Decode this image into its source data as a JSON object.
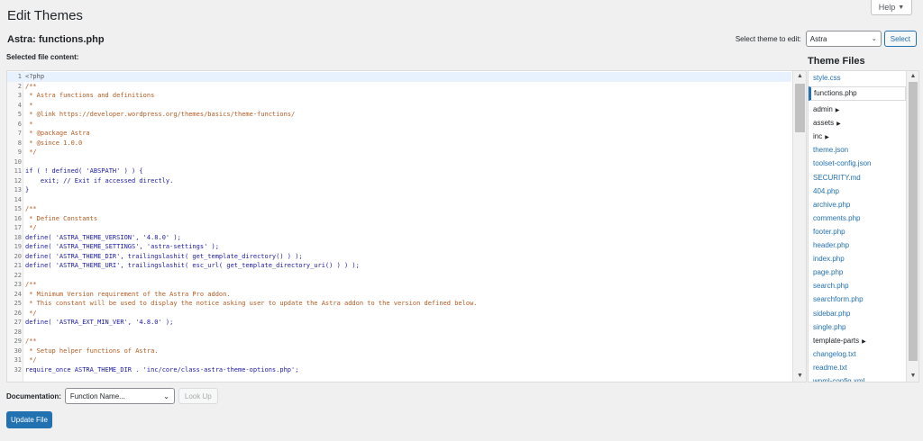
{
  "header": {
    "title": "Edit Themes",
    "help_label": "Help",
    "help_caret": "▼"
  },
  "file_heading": "Astra: functions.php",
  "theme_selector": {
    "label": "Select theme to edit:",
    "value": "Astra",
    "button_label": "Select"
  },
  "editor": {
    "label": "Selected file content:",
    "lines": [
      {
        "n": "1",
        "t": "<?php",
        "k": "php"
      },
      {
        "n": "2",
        "t": "/**",
        "k": "comment"
      },
      {
        "n": "3",
        "t": " * Astra functions and definitions",
        "k": "comment"
      },
      {
        "n": "4",
        "t": " *",
        "k": "comment"
      },
      {
        "n": "5",
        "t": " * @link https://developer.wordpress.org/themes/basics/theme-functions/",
        "k": "comment"
      },
      {
        "n": "6",
        "t": " *",
        "k": "comment"
      },
      {
        "n": "7",
        "t": " * @package Astra",
        "k": "comment"
      },
      {
        "n": "8",
        "t": " * @since 1.0.0",
        "k": "comment"
      },
      {
        "n": "9",
        "t": " */",
        "k": "comment"
      },
      {
        "n": "10",
        "t": "",
        "k": "plain"
      },
      {
        "n": "11",
        "t": "if ( ! defined( 'ABSPATH' ) ) {",
        "k": "kw"
      },
      {
        "n": "12",
        "t": "    exit; // Exit if accessed directly.",
        "k": "kw"
      },
      {
        "n": "13",
        "t": "}",
        "k": "kw"
      },
      {
        "n": "14",
        "t": "",
        "k": "plain"
      },
      {
        "n": "15",
        "t": "/**",
        "k": "comment"
      },
      {
        "n": "16",
        "t": " * Define Constants",
        "k": "comment"
      },
      {
        "n": "17",
        "t": " */",
        "k": "comment"
      },
      {
        "n": "18",
        "t": "define( 'ASTRA_THEME_VERSION', '4.8.0' );",
        "k": "kw"
      },
      {
        "n": "19",
        "t": "define( 'ASTRA_THEME_SETTINGS', 'astra-settings' );",
        "k": "kw"
      },
      {
        "n": "20",
        "t": "define( 'ASTRA_THEME_DIR', trailingslashit( get_template_directory() ) );",
        "k": "kw"
      },
      {
        "n": "21",
        "t": "define( 'ASTRA_THEME_URI', trailingslashit( esc_url( get_template_directory_uri() ) ) );",
        "k": "kw"
      },
      {
        "n": "22",
        "t": "",
        "k": "plain"
      },
      {
        "n": "23",
        "t": "/**",
        "k": "comment"
      },
      {
        "n": "24",
        "t": " * Minimum Version requirement of the Astra Pro addon.",
        "k": "comment"
      },
      {
        "n": "25",
        "t": " * This constant will be used to display the notice asking user to update the Astra addon to the version defined below.",
        "k": "comment"
      },
      {
        "n": "26",
        "t": " */",
        "k": "comment"
      },
      {
        "n": "27",
        "t": "define( 'ASTRA_EXT_MIN_VER', '4.8.0' );",
        "k": "kw"
      },
      {
        "n": "28",
        "t": "",
        "k": "plain"
      },
      {
        "n": "29",
        "t": "/**",
        "k": "comment"
      },
      {
        "n": "30",
        "t": " * Setup helper functions of Astra.",
        "k": "comment"
      },
      {
        "n": "31",
        "t": " */",
        "k": "comment"
      },
      {
        "n": "32",
        "t": "require_once ASTRA_THEME_DIR . 'inc/core/class-astra-theme-options.php';",
        "k": "kw"
      }
    ]
  },
  "theme_files": {
    "title": "Theme Files",
    "items": [
      {
        "label": "style.css",
        "type": "file"
      },
      {
        "label": "functions.php",
        "type": "current"
      },
      {
        "label": "admin",
        "type": "folder"
      },
      {
        "label": "assets",
        "type": "folder"
      },
      {
        "label": "inc",
        "type": "folder"
      },
      {
        "label": "theme.json",
        "type": "file"
      },
      {
        "label": "toolset-config.json",
        "type": "file"
      },
      {
        "label": "SECURITY.md",
        "type": "file"
      },
      {
        "label": "404.php",
        "type": "file"
      },
      {
        "label": "archive.php",
        "type": "file"
      },
      {
        "label": "comments.php",
        "type": "file"
      },
      {
        "label": "footer.php",
        "type": "file"
      },
      {
        "label": "header.php",
        "type": "file"
      },
      {
        "label": "index.php",
        "type": "file"
      },
      {
        "label": "page.php",
        "type": "file"
      },
      {
        "label": "search.php",
        "type": "file"
      },
      {
        "label": "searchform.php",
        "type": "file"
      },
      {
        "label": "sidebar.php",
        "type": "file"
      },
      {
        "label": "single.php",
        "type": "file"
      },
      {
        "label": "template-parts",
        "type": "folder"
      },
      {
        "label": "changelog.txt",
        "type": "file"
      },
      {
        "label": "readme.txt",
        "type": "file"
      },
      {
        "label": "wpml-config.xml",
        "type": "file"
      }
    ]
  },
  "documentation": {
    "label": "Documentation:",
    "select_value": "Function Name...",
    "lookup_label": "Look Up"
  },
  "update_button_label": "Update File",
  "colors": {
    "accent": "#2271b1",
    "background": "#f0f0f1"
  },
  "icons": {
    "folder_arrow": "▶",
    "scroll_up": "▲",
    "scroll_down": "▼",
    "select_chevron": "⌄"
  }
}
